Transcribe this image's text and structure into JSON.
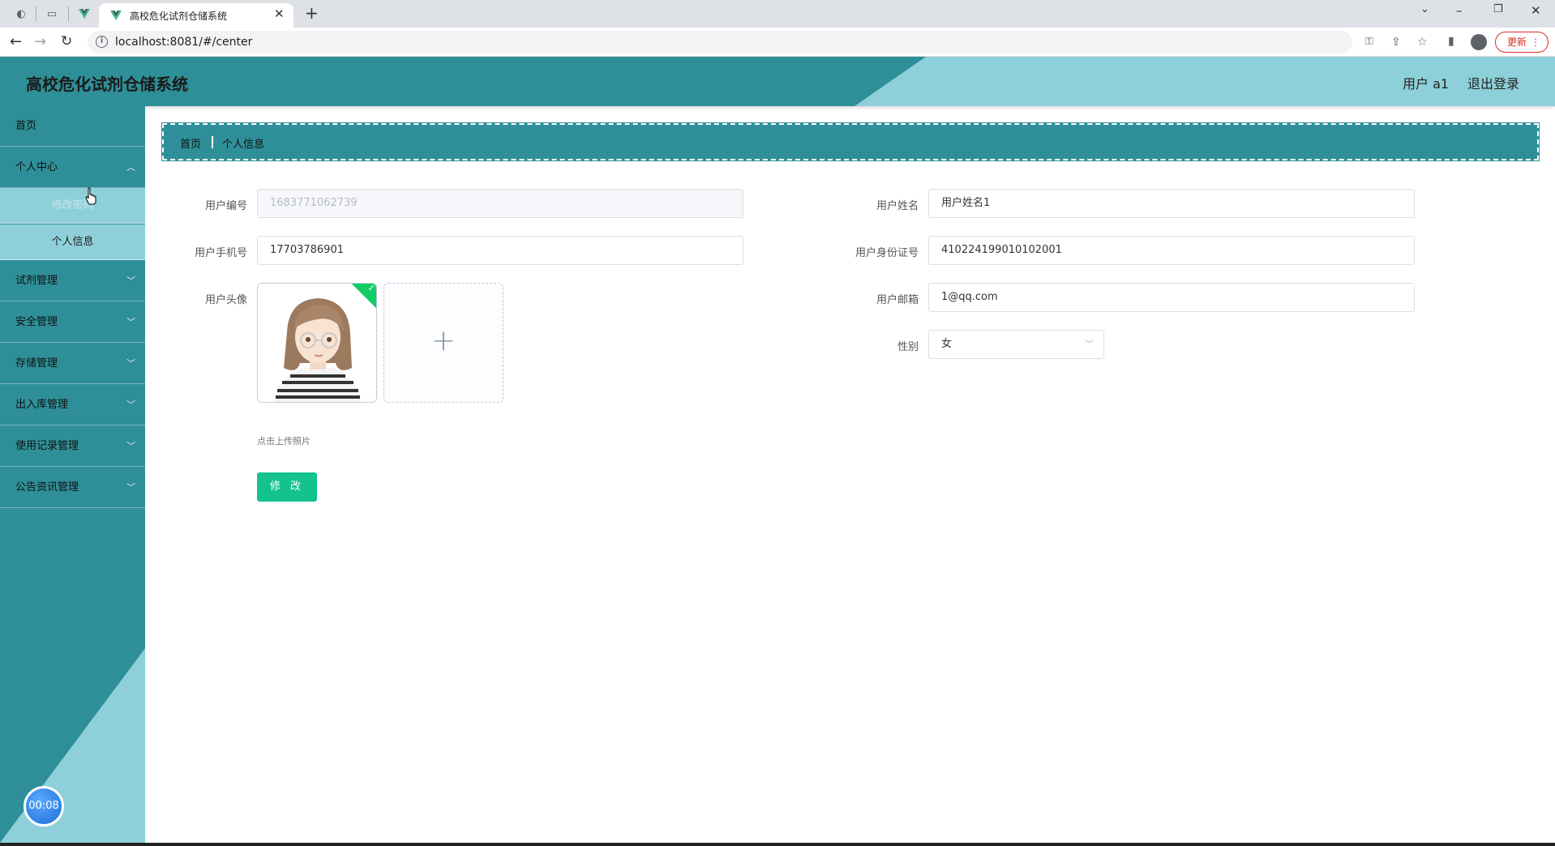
{
  "browser": {
    "tab_title": "高校危化试剂仓储系统",
    "url": "localhost:8081/#/center",
    "update_label": "更新"
  },
  "header": {
    "title": "高校危化试剂仓储系统",
    "user": "用户 a1",
    "logout": "退出登录"
  },
  "sidebar": {
    "home": "首页",
    "personal_center": "个人中心",
    "sub_change_password": "修改密码",
    "sub_personal_info": "个人信息",
    "reagent_mgmt": "试剂管理",
    "safety_mgmt": "安全管理",
    "storage_mgmt": "存储管理",
    "inout_mgmt": "出入库管理",
    "usage_mgmt": "使用记录管理",
    "notice_mgmt": "公告资讯管理",
    "timer": "00:08"
  },
  "breadcrumb": {
    "home": "首页",
    "current": "个人信息"
  },
  "form": {
    "user_id_label": "用户编号",
    "user_id_value": "1683771062739",
    "user_name_label": "用户姓名",
    "user_name_value": "用户姓名1",
    "phone_label": "用户手机号",
    "phone_value": "17703786901",
    "id_card_label": "用户身份证号",
    "id_card_value": "410224199010102001",
    "avatar_label": "用户头像",
    "email_label": "用户邮箱",
    "email_value": "1@qq.com",
    "gender_label": "性别",
    "gender_value": "女",
    "upload_tip": "点击上传照片",
    "submit_label": "修 改"
  },
  "colors": {
    "primary": "#2e8f98",
    "accent": "#8ed0d9",
    "button": "#13c28c"
  }
}
